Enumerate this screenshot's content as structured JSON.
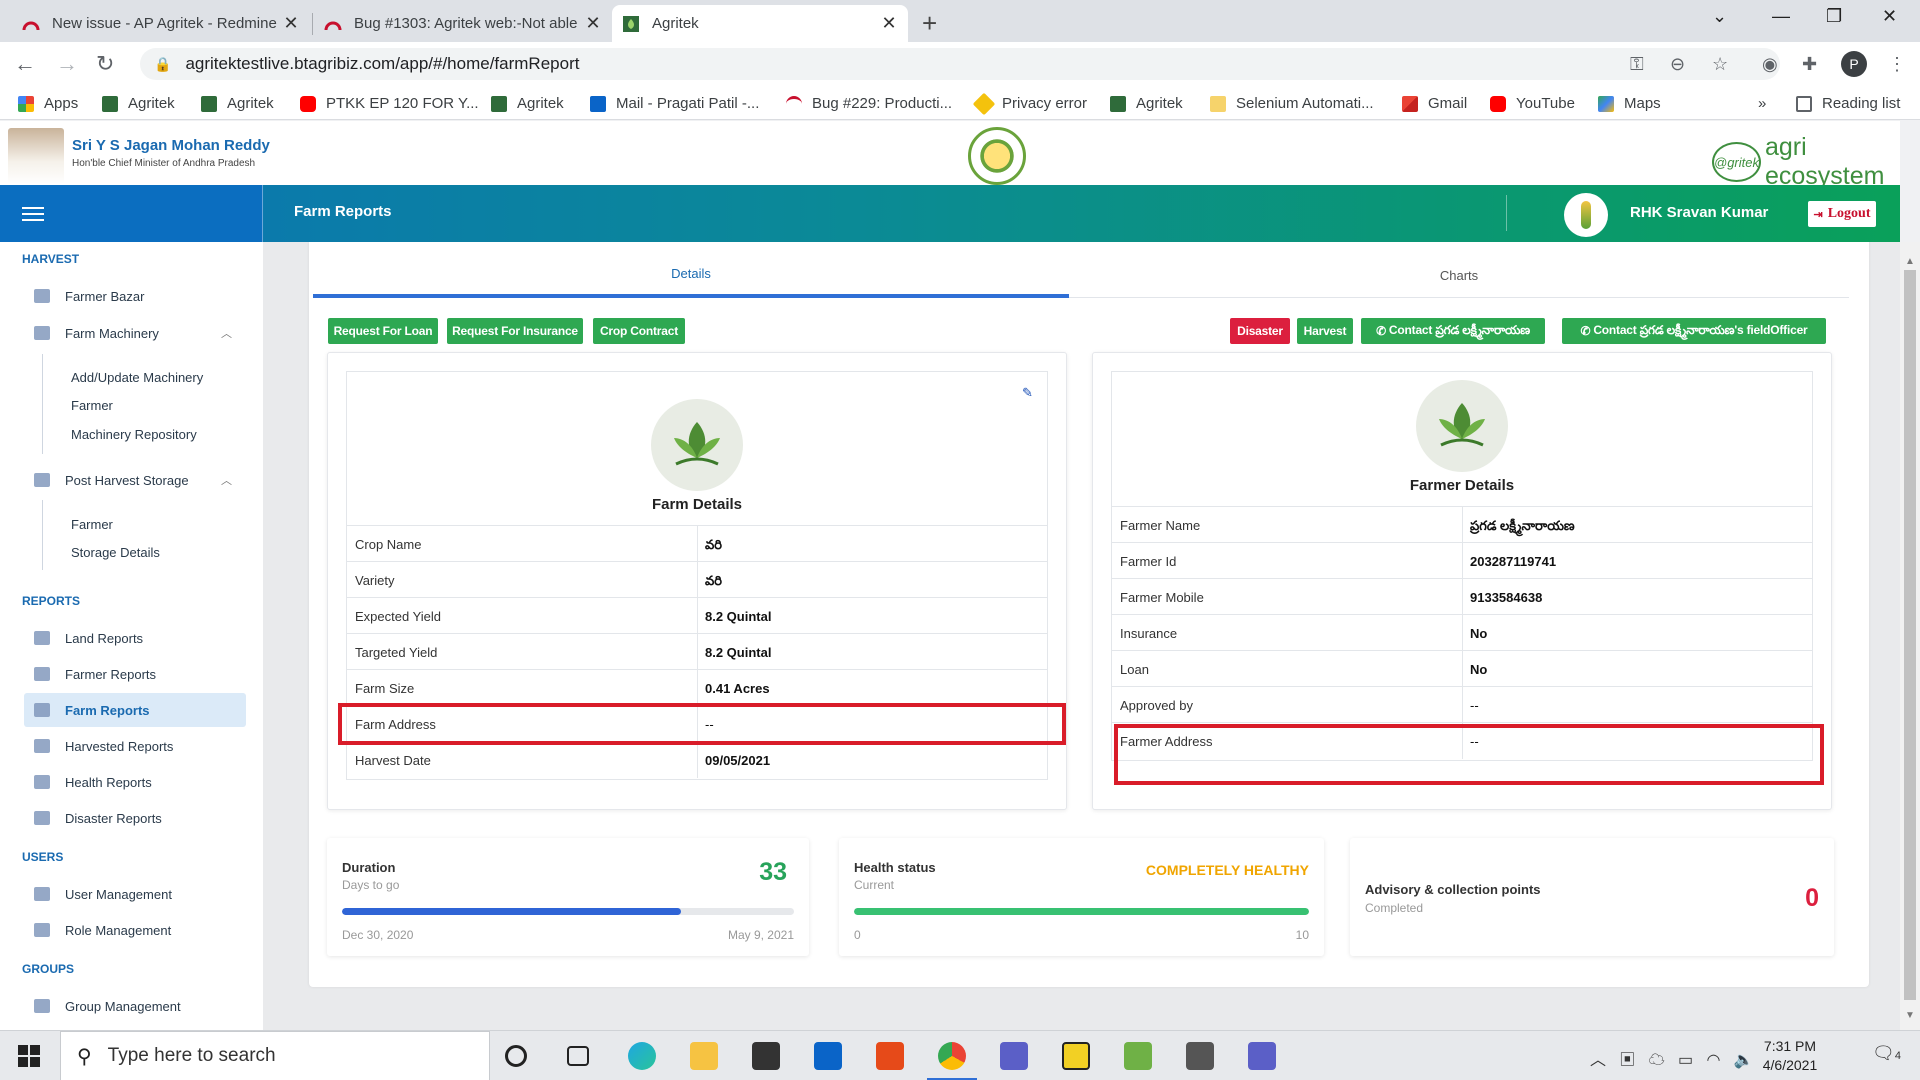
{
  "browser": {
    "tabs": [
      {
        "title": "New issue - AP Agritek - Redmine",
        "active": false
      },
      {
        "title": "Bug #1303: Agritek web:-Not able",
        "active": false
      },
      {
        "title": "Agritek",
        "active": true
      }
    ],
    "url": "agritektestlive.btagribiz.com/app/#/home/farmReport",
    "profile_initial": "P",
    "bookmarks": [
      "Apps",
      "Agritek",
      "Agritek",
      "PTKK EP 120 FOR Y...",
      "Agritek",
      "Mail - Pragati Patil -...",
      "Bug #229: Producti...",
      "Privacy error",
      "Agritek",
      "Selenium Automati...",
      "Gmail",
      "YouTube",
      "Maps"
    ],
    "bookmarks_more": "»",
    "reading_list": "Reading list"
  },
  "header": {
    "cm_name": "Sri Y S Jagan Mohan Reddy",
    "cm_title": "Hon'ble Chief Minister of Andhra Pradesh",
    "logo_circle_text": "@gritek",
    "logo_text": "agri ecosystem"
  },
  "topbar": {
    "page_title": "Farm Reports",
    "user_name": "RHK Sravan Kumar",
    "logout_label": "Logout"
  },
  "sidebar": {
    "sections": {
      "harvest": "HARVEST",
      "reports": "REPORTS",
      "users": "USERS",
      "groups": "GROUPS"
    },
    "items": {
      "farmer_bazar": "Farmer Bazar",
      "farm_machinery": "Farm Machinery",
      "add_update_machinery": "Add/Update Machinery",
      "fm_farmer": "Farmer",
      "machinery_repository": "Machinery Repository",
      "post_harvest_storage": "Post Harvest Storage",
      "ph_farmer": "Farmer",
      "storage_details": "Storage Details",
      "land_reports": "Land Reports",
      "farmer_reports": "Farmer Reports",
      "farm_reports": "Farm Reports",
      "harvested_reports": "Harvested Reports",
      "health_reports": "Health Reports",
      "disaster_reports": "Disaster Reports",
      "user_management": "User Management",
      "role_management": "Role Management",
      "group_management": "Group Management"
    }
  },
  "main": {
    "tabs": {
      "details": "Details",
      "charts": "Charts"
    },
    "left_buttons": [
      "Request For Loan",
      "Request For Insurance",
      "Crop Contract"
    ],
    "right_buttons": {
      "disaster": "Disaster",
      "harvest": "Harvest",
      "contact_farmer": "Contact ప్రగడ లక్ష్మీనారాయణ",
      "contact_officer": "Contact ప్రగడ లక్ష్మీనారాయణ's fieldOfficer"
    },
    "farm": {
      "heading": "Farm Details",
      "rows": [
        {
          "label": "Crop Name",
          "value": "వరి"
        },
        {
          "label": "Variety",
          "value": "వరి"
        },
        {
          "label": "Expected Yield",
          "value": "8.2 Quintal"
        },
        {
          "label": "Targeted Yield",
          "value": "8.2 Quintal"
        },
        {
          "label": "Farm Size",
          "value": "0.41 Acres"
        },
        {
          "label": "Farm Address",
          "value": "--"
        },
        {
          "label": "Harvest Date",
          "value": "09/05/2021"
        }
      ]
    },
    "farmer": {
      "heading": "Farmer Details",
      "rows": [
        {
          "label": "Farmer Name",
          "value": "ప్రగడ లక్ష్మీనారాయణ"
        },
        {
          "label": "Farmer Id",
          "value": "203287119741"
        },
        {
          "label": "Farmer Mobile",
          "value": "9133584638"
        },
        {
          "label": "Insurance",
          "value": "No"
        },
        {
          "label": "Loan",
          "value": "No"
        },
        {
          "label": "Approved by",
          "value": "--"
        },
        {
          "label": "Farmer Address",
          "value": "--"
        }
      ]
    },
    "stats": {
      "duration": {
        "title": "Duration",
        "sub": "Days to go",
        "value": "33",
        "progress": 0.75,
        "start": "Dec 30, 2020",
        "end": "May 9, 2021"
      },
      "health": {
        "title": "Health status",
        "sub": "Current",
        "value": "COMPLETELY HEALTHY",
        "progress": 1.0,
        "min": "0",
        "max": "10"
      },
      "advisory": {
        "title": "Advisory & collection points",
        "sub": "Completed",
        "value": "0"
      }
    }
  },
  "taskbar": {
    "search_placeholder": "Type here to search",
    "time": "7:31 PM",
    "date": "4/6/2021",
    "notif_count": "4"
  },
  "colors": {
    "accent": "#1a6ab0",
    "green": "#2ea852",
    "red": "#dc1f3e",
    "highlight": "#d91c29",
    "warning": "#f0a500"
  }
}
